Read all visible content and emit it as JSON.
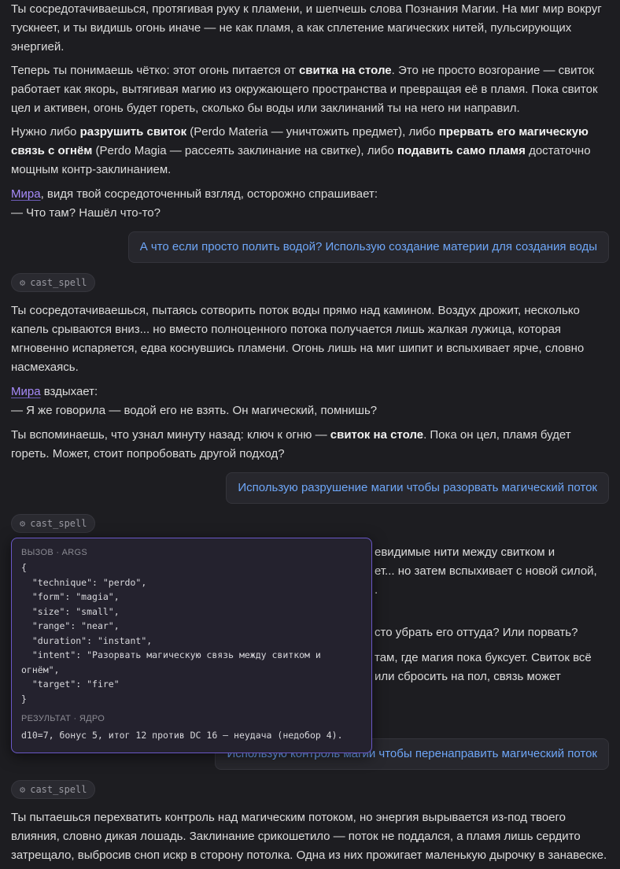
{
  "messages": {
    "p1": "Ты сосредотачиваешься, протягивая руку к пламени, и шепчешь слова Познания Магии. На миг мир вокруг тускнеет, и ты видишь огонь иначе — не как пламя, а как сплетение магических нитей, пульсирующих энергией.",
    "p2": {
      "a": "Теперь ты понимаешь чётко: этот огонь питается от ",
      "b": "свитка на столе",
      "c": ". Это не просто возгорание — свиток работает как якорь, вытягивая магию из окружающего пространства и превращая её в пламя. Пока свиток цел и активен, огонь будет гореть, сколько бы воды или заклинаний ты на него ни направил."
    },
    "p3": {
      "a": "Нужно либо ",
      "b": "разрушить свиток",
      "c": " (Perdo Materia — уничтожить предмет), либо ",
      "d": "прервать его магическую связь с огнём",
      "e": " (Perdo Magia — рассеять заклинание на свитке), либо ",
      "f": "подавить само пламя",
      "g": " достаточно мощным контр-заклинанием."
    },
    "p4": {
      "npc": "Мира",
      "a": ", видя твой сосредоточенный взгляд, осторожно спрашивает:",
      "b": "— Что там? Нашёл что-то?"
    },
    "user1": "А что если просто полить водой? Использую создание материи для создания воды",
    "tool1": "cast_spell",
    "p5": "Ты сосредотачиваешься, пытаясь сотворить поток воды прямо над камином. Воздух дрожит, несколько капель срываются вниз... но вместо полноценного потока получается лишь жалкая лужица, которая мгновенно испаряется, едва коснувшись пламени. Огонь лишь на миг шипит и вспыхивает ярче, словно насмехаясь.",
    "p6": {
      "npc": "Мира",
      "a": " вздыхает:",
      "b": "— Я же говорила — водой его не взять. Он магический, помнишь?"
    },
    "p7": {
      "a": "Ты вспоминаешь, что узнал минуту назад: ключ к огню — ",
      "b": "свиток на столе",
      "c": ". Пока он цел, пламя будет гореть. Может, стоит попробовать другой подход?"
    },
    "user2": "Использую разрушение магии чтобы разорвать магический поток",
    "tool2": "cast_spell",
    "hidden_fragments": {
      "f1": "евидимые нити между свитком и",
      "f2": "ет... но затем вспыхивает с новой силой,",
      "f3": ".",
      "f4": "сто убрать его оттуда? Или порвать?",
      "f5": "там, где магия пока буксует. Свиток всё",
      "f6": " или сбросить на пол, связь может"
    },
    "user3": "Использую контроль магии чтобы перенаправить магический поток",
    "tool3": "cast_spell",
    "p8": "Ты пытаешься перехватить контроль над магическим потоком, но энергия вырывается из-под твоего влияния, словно дикая лошадь. Заклинание срикошетило — поток не поддался, а пламя лишь сердито затрещало, выбросив сноп искр в сторону потолка. Одна из них прожигает маленькую дырочку в занавеске."
  },
  "popup": {
    "args_label": "ВЫЗОВ · ARGS",
    "args_json": "{\n  \"technique\": \"perdo\",\n  \"form\": \"magia\",\n  \"size\": \"small\",\n  \"range\": \"near\",\n  \"duration\": \"instant\",\n  \"intent\": \"Разорвать магическую связь между свитком и огнём\",\n  \"target\": \"fire\"\n}",
    "result_label": "РЕЗУЛЬТАТ · ЯДРО",
    "result_text": "d10=7, бонус 5, итог 12 против DC 16 — неудача (недобор 4)."
  },
  "icons": {
    "tool": "gear-icon"
  },
  "colors": {
    "accent": "#6a58c7",
    "user_text": "#6ea6f7",
    "npc": "#a78bfa",
    "bg": "#1d1d21"
  }
}
